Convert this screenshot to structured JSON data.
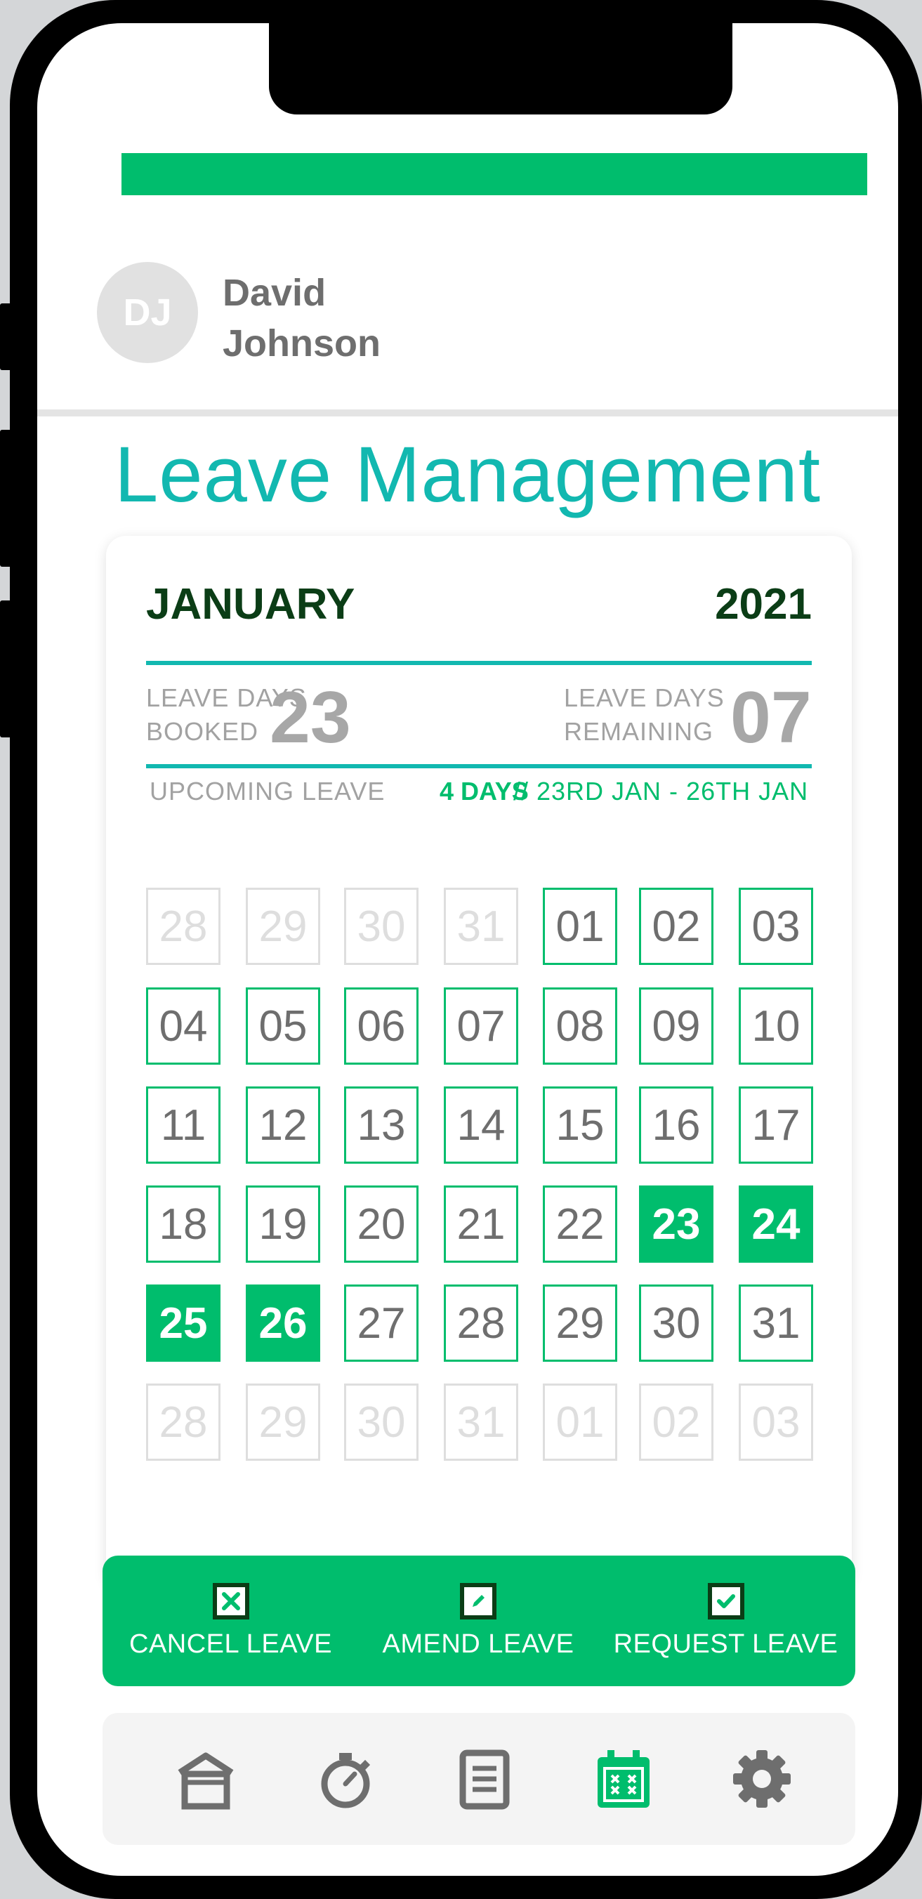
{
  "colors": {
    "accent": "#00bd6d",
    "title": "#12b8b0",
    "dark": "#0b3d16",
    "muted": "#a2a2a2"
  },
  "user": {
    "initials": "DJ",
    "first_name": "David",
    "last_name": "Johnson"
  },
  "page": {
    "title": "Leave Management"
  },
  "calendar": {
    "month": "JANUARY",
    "year": "2021",
    "booked_label_1": "LEAVE DAYS",
    "booked_label_2": "BOOKED",
    "booked_value": "23",
    "remaining_label_1": "LEAVE DAYS",
    "remaining_label_2": "REMAINING",
    "remaining_value": "07",
    "upcoming_label": "UPCOMING LEAVE",
    "upcoming_days": "4 DAYS",
    "upcoming_range": "// 23RD JAN - 26TH JAN",
    "days": [
      {
        "label": "28",
        "state": "outside"
      },
      {
        "label": "29",
        "state": "outside"
      },
      {
        "label": "30",
        "state": "outside"
      },
      {
        "label": "31",
        "state": "outside"
      },
      {
        "label": "01",
        "state": "normal"
      },
      {
        "label": "02",
        "state": "normal"
      },
      {
        "label": "03",
        "state": "normal"
      },
      {
        "label": "04",
        "state": "normal"
      },
      {
        "label": "05",
        "state": "normal"
      },
      {
        "label": "06",
        "state": "normal"
      },
      {
        "label": "07",
        "state": "normal"
      },
      {
        "label": "08",
        "state": "normal"
      },
      {
        "label": "09",
        "state": "normal"
      },
      {
        "label": "10",
        "state": "normal"
      },
      {
        "label": "11",
        "state": "normal"
      },
      {
        "label": "12",
        "state": "normal"
      },
      {
        "label": "13",
        "state": "normal"
      },
      {
        "label": "14",
        "state": "normal"
      },
      {
        "label": "15",
        "state": "normal"
      },
      {
        "label": "16",
        "state": "normal"
      },
      {
        "label": "17",
        "state": "normal"
      },
      {
        "label": "18",
        "state": "normal"
      },
      {
        "label": "19",
        "state": "normal"
      },
      {
        "label": "20",
        "state": "normal"
      },
      {
        "label": "21",
        "state": "normal"
      },
      {
        "label": "22",
        "state": "normal"
      },
      {
        "label": "23",
        "state": "booked"
      },
      {
        "label": "24",
        "state": "booked"
      },
      {
        "label": "25",
        "state": "booked"
      },
      {
        "label": "26",
        "state": "booked"
      },
      {
        "label": "27",
        "state": "normal"
      },
      {
        "label": "28",
        "state": "normal"
      },
      {
        "label": "29",
        "state": "normal"
      },
      {
        "label": "30",
        "state": "normal"
      },
      {
        "label": "31",
        "state": "normal"
      },
      {
        "label": "28",
        "state": "outside"
      },
      {
        "label": "29",
        "state": "outside"
      },
      {
        "label": "30",
        "state": "outside"
      },
      {
        "label": "31",
        "state": "outside"
      },
      {
        "label": "01",
        "state": "outside"
      },
      {
        "label": "02",
        "state": "outside"
      },
      {
        "label": "03",
        "state": "outside"
      }
    ]
  },
  "actions": {
    "cancel": {
      "label": "CANCEL LEAVE",
      "icon": "x-box-icon"
    },
    "amend": {
      "label": "AMEND LEAVE",
      "icon": "pencil-box-icon"
    },
    "request": {
      "label": "REQUEST LEAVE",
      "icon": "check-box-icon"
    }
  },
  "nav": {
    "items": [
      {
        "icon": "home-icon",
        "active": false
      },
      {
        "icon": "stopwatch-icon",
        "active": false
      },
      {
        "icon": "document-icon",
        "active": false
      },
      {
        "icon": "calendar-icon",
        "active": true
      },
      {
        "icon": "gear-icon",
        "active": false
      }
    ]
  }
}
